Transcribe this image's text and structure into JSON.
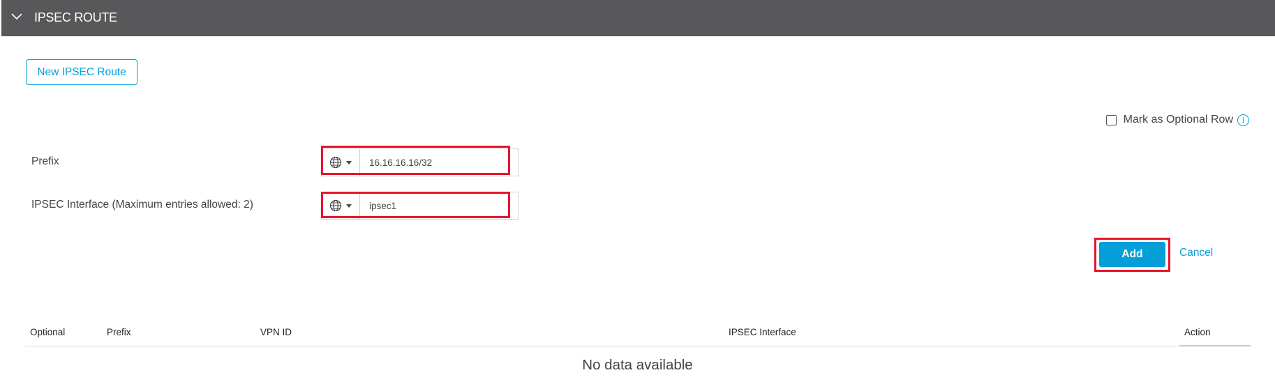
{
  "section": {
    "title": "IPSEC ROUTE",
    "toggle_icon": "chevron-down-icon"
  },
  "new_route_button": "New IPSEC Route",
  "optional_row": {
    "label": "Mark as Optional Row",
    "checked": false,
    "info_icon": "info-icon"
  },
  "form": {
    "prefix": {
      "label": "Prefix",
      "value": "16.16.16.16/32",
      "scope_icon": "globe-icon"
    },
    "ipsec_interface": {
      "label": "IPSEC Interface (Maximum entries allowed: 2)",
      "value": "ipsec1",
      "scope_icon": "globe-icon"
    }
  },
  "actions": {
    "add": "Add",
    "cancel": "Cancel"
  },
  "table": {
    "columns": [
      "Optional",
      "Prefix",
      "VPN ID",
      "IPSEC Interface",
      "Action"
    ],
    "empty_message": "No data available"
  },
  "colors": {
    "header_bg": "#58585a",
    "accent": "#049fd9",
    "highlight": "#e8142a"
  }
}
